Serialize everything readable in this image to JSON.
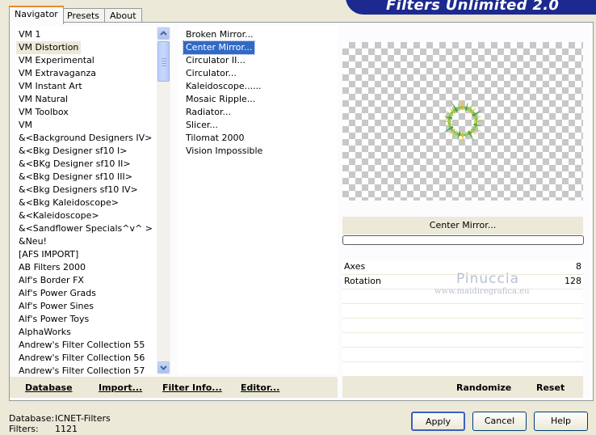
{
  "header": {
    "title": "Filters Unlimited 2.0"
  },
  "tabs": [
    {
      "label": "Navigator"
    },
    {
      "label": "Presets"
    },
    {
      "label": "About"
    }
  ],
  "categories": [
    "VM 1",
    "VM Distortion",
    "VM Experimental",
    "VM Extravaganza",
    "VM Instant Art",
    "VM Natural",
    "VM Toolbox",
    "VM",
    "&<Background Designers IV>",
    "&<Bkg Designer sf10 I>",
    "&<BKg Designer sf10 II>",
    "&<Bkg Designer sf10 III>",
    "&<Bkg Designers sf10 IV>",
    "&<Bkg Kaleidoscope>",
    "&<Kaleidoscope>",
    "&<Sandflower Specials^v^ >",
    "&Neu!",
    "[AFS IMPORT]",
    "AB Filters 2000",
    "Alf's Border FX",
    "Alf's Power Grads",
    "Alf's Power Sines",
    "Alf's Power Toys",
    "AlphaWorks",
    "Andrew's Filter Collection 55",
    "Andrew's Filter Collection 56",
    "Andrew's Filter Collection 57"
  ],
  "selected_category": 1,
  "filters": [
    "Broken Mirror...",
    "Center Mirror...",
    "Circulator II...",
    "Circulator...",
    "Kaleidoscope......",
    "Mosaic Ripple...",
    "Radiator...",
    "Slicer...",
    "Tilomat 2000",
    "Vision Impossible"
  ],
  "selected_filter": 1,
  "filter_name": "Center Mirror...",
  "params": [
    {
      "label": "Axes",
      "value": "8"
    },
    {
      "label": "Rotation",
      "value": "128"
    }
  ],
  "watermark": {
    "name": "Pinuccia",
    "site": "www.maidiregrafica.eu"
  },
  "left_buttons": [
    {
      "label": "Database",
      "hotkey": "D"
    },
    {
      "label": "Import...",
      "hotkey": "I"
    },
    {
      "label": "Filter Info...",
      "hotkey": "I"
    },
    {
      "label": "Editor...",
      "hotkey": "E"
    }
  ],
  "right_buttons": [
    {
      "label": "Randomize"
    },
    {
      "label": "Reset"
    }
  ],
  "status": {
    "db_label": "Database:",
    "db_value": "ICNET-Filters",
    "filters_label": "Filters:",
    "filters_value": "1121"
  },
  "dialog": {
    "apply": "Apply",
    "cancel": "Cancel",
    "help": "Help"
  },
  "colors": {
    "banner": "#1c2a8f",
    "selection": "#316ac5",
    "tab_accent": "#e68b2c"
  }
}
